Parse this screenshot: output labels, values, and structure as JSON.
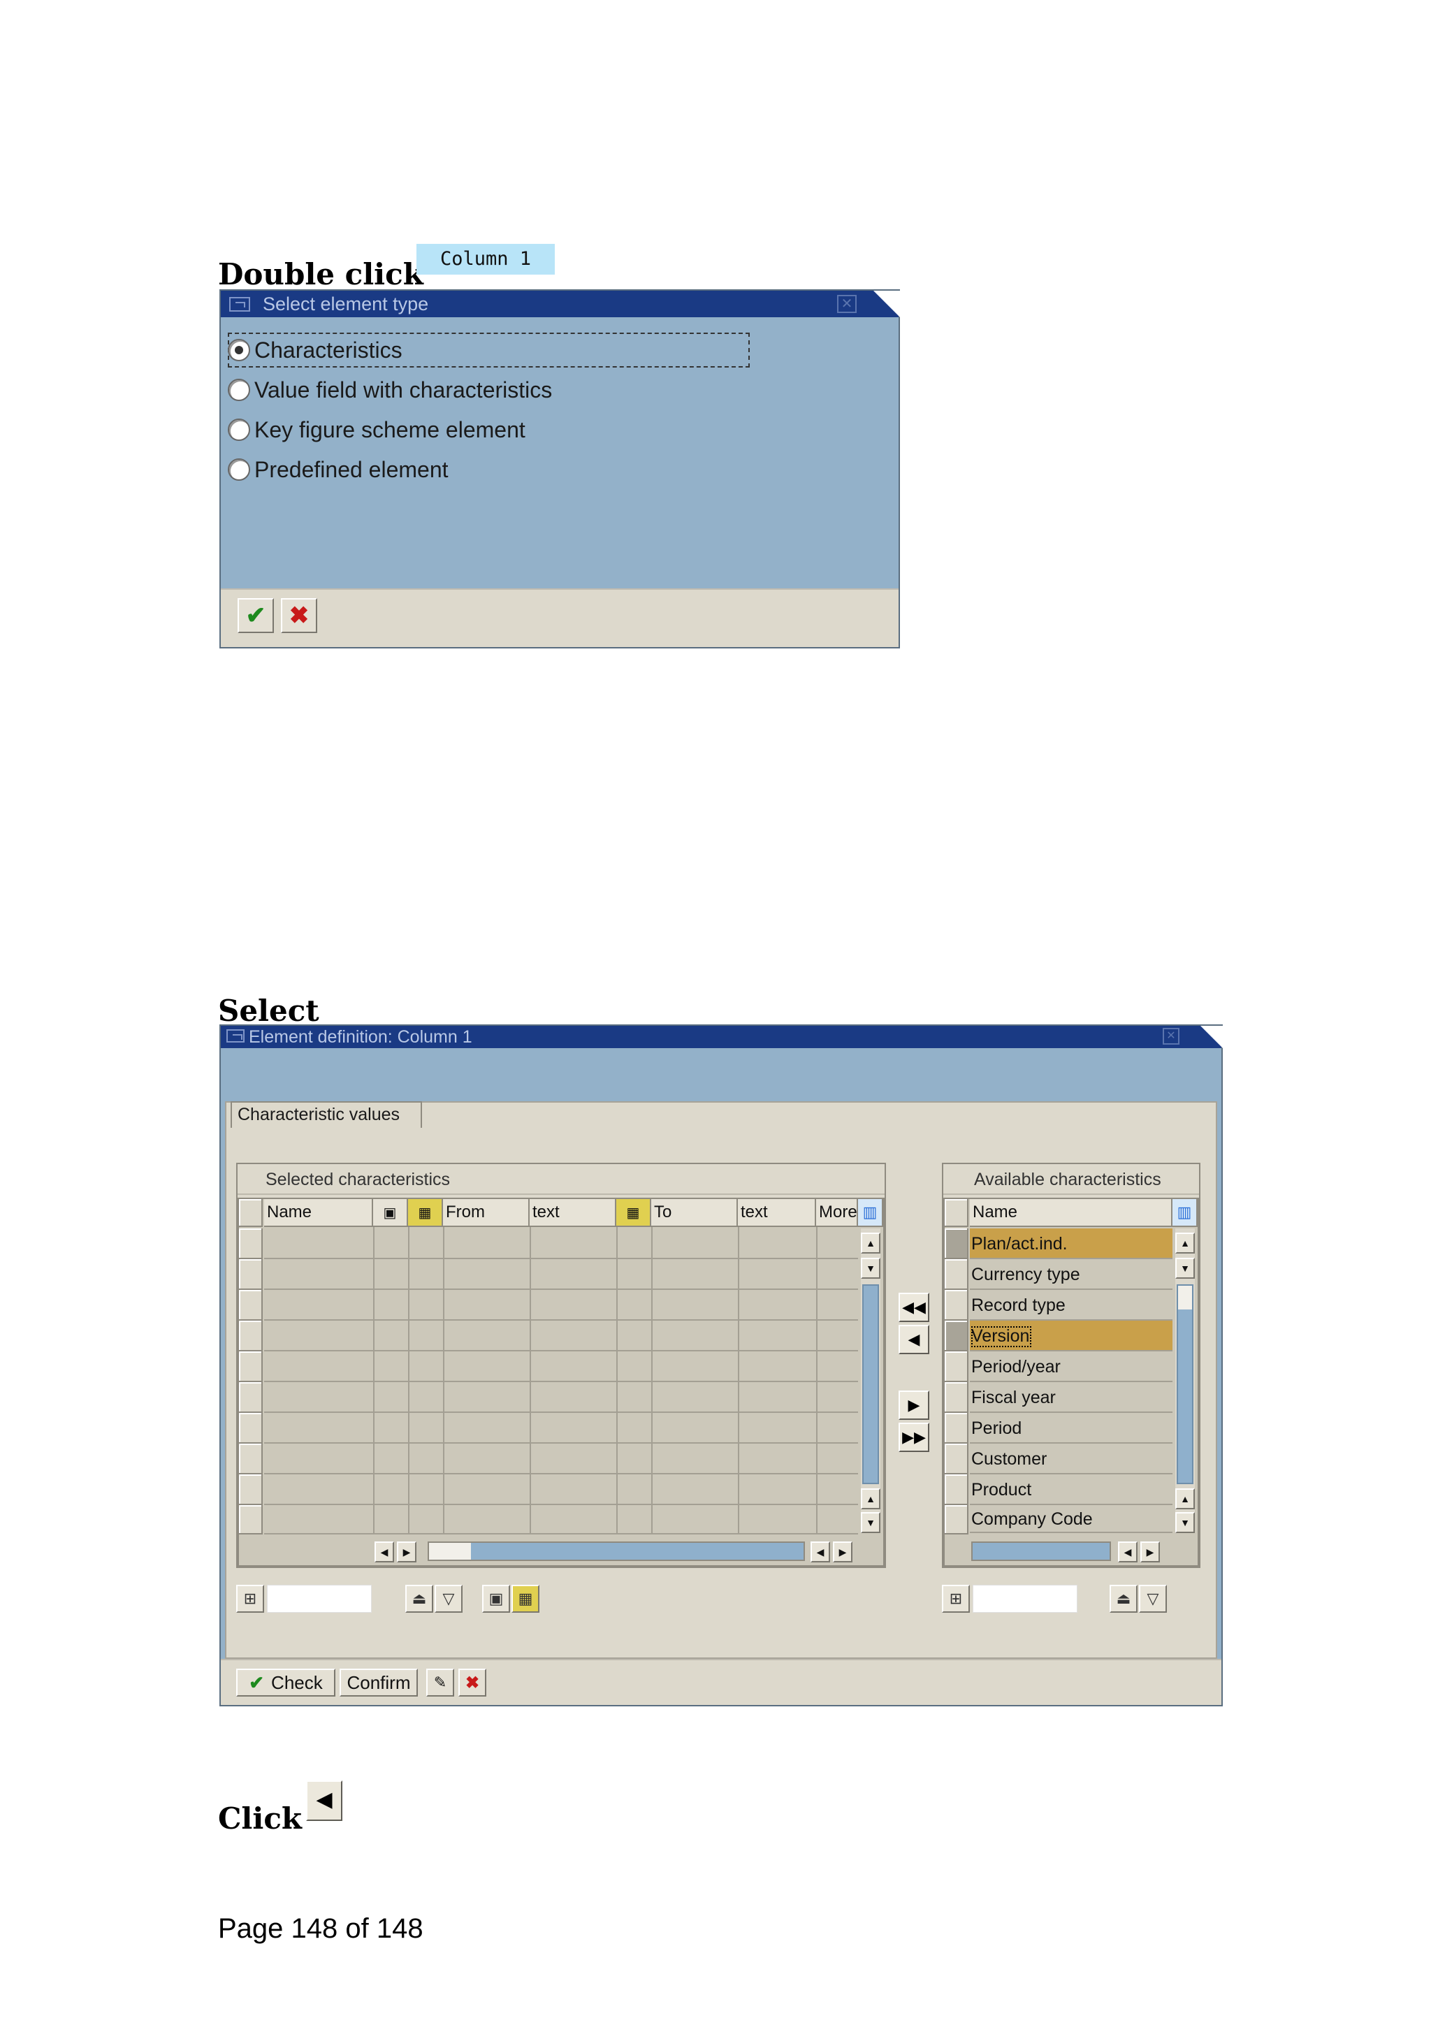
{
  "step1": {
    "label": "Double click",
    "column_chip": "Column 1"
  },
  "dialog1": {
    "title": "Select element type",
    "options": [
      {
        "label": "Characteristics",
        "selected": true
      },
      {
        "label": "Value field with characteristics",
        "selected": false
      },
      {
        "label": "Key figure scheme element",
        "selected": false
      },
      {
        "label": "Predefined element",
        "selected": false
      }
    ]
  },
  "step2": {
    "label": "Select"
  },
  "dialog2": {
    "title": "Element definition: Column 1",
    "tab": "Characteristic values",
    "selected_group": {
      "title": "Selected characteristics",
      "columns": [
        "Name",
        "From",
        "text",
        "To",
        "text",
        "More"
      ]
    },
    "available_group": {
      "title": "Available characteristics",
      "column": "Name",
      "rows": [
        {
          "name": "Plan/act.ind.",
          "highlighted": true
        },
        {
          "name": "Currency type",
          "highlighted": false
        },
        {
          "name": "Record type",
          "highlighted": false
        },
        {
          "name": "Version",
          "highlighted": true
        },
        {
          "name": "Period/year",
          "highlighted": false
        },
        {
          "name": "Fiscal year",
          "highlighted": false
        },
        {
          "name": "Period",
          "highlighted": false
        },
        {
          "name": "Customer",
          "highlighted": false
        },
        {
          "name": "Product",
          "highlighted": false
        },
        {
          "name": "Company Code",
          "highlighted": false
        }
      ]
    },
    "buttons": {
      "check": "Check",
      "confirm": "Confirm"
    }
  },
  "step3": {
    "label": "Click"
  },
  "footer": "Page 148 of 148",
  "colors": {
    "title_bar": "#1a3a84",
    "window_bg": "#93b1c9",
    "panel_bg": "#ddd9cc",
    "highlight": "#c9a04a"
  }
}
